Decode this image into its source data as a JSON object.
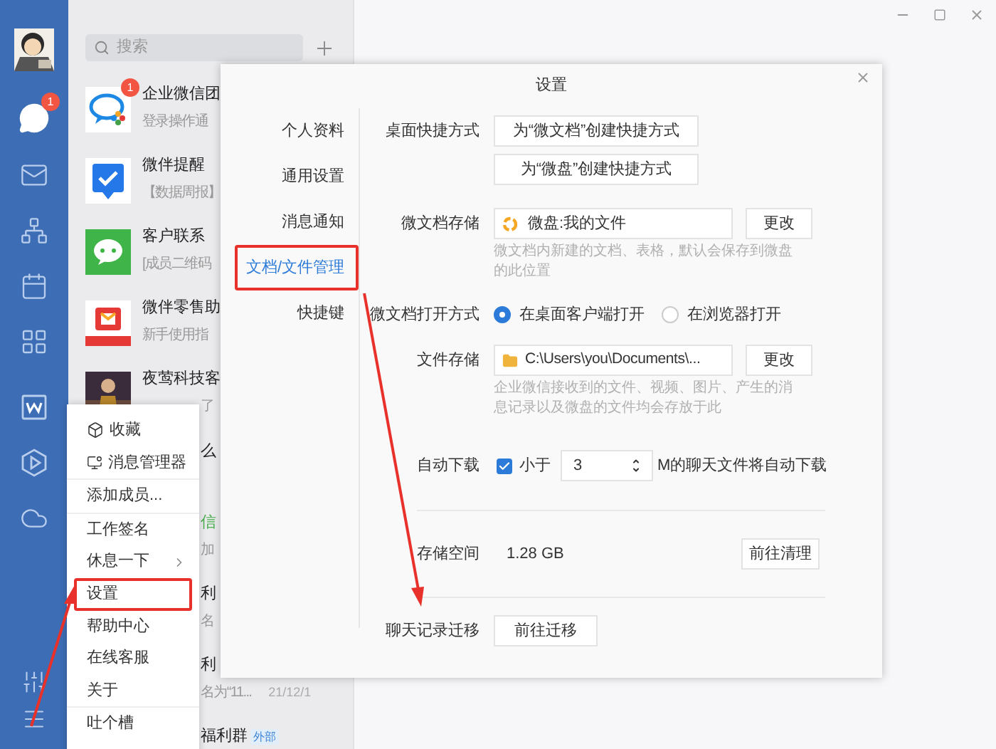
{
  "sidebar": {
    "badge": "1"
  },
  "search": {
    "placeholder": "搜索"
  },
  "chats": [
    {
      "kind": "full",
      "title": "企业微信团",
      "preview": "登录操作通",
      "badge": "1"
    },
    {
      "kind": "full",
      "title": "微伴提醒",
      "preview": "【数据周报】"
    },
    {
      "kind": "full",
      "title": "客户联系",
      "preview": "[成员二维码"
    },
    {
      "kind": "full",
      "title": "微伴零售助",
      "preview": "新手使用指"
    },
    {
      "kind": "half",
      "title": "夜莺科技客",
      "preview": "了"
    },
    {
      "kind": "covered",
      "title": "么"
    },
    {
      "kind": "covered",
      "title": "信",
      "color": "#4caf50",
      "preview": "加"
    },
    {
      "kind": "covered",
      "title": "利",
      "preview": "名"
    },
    {
      "kind": "covered",
      "title": "利",
      "preview": "名为“11...",
      "time": "21/12/1"
    },
    {
      "kind": "covered",
      "title": "福利群",
      "tag": "外部"
    }
  ],
  "settings": {
    "title": "设置",
    "nav": [
      {
        "label": "个人资料",
        "selected": false,
        "highlighted": false
      },
      {
        "label": "通用设置",
        "selected": false,
        "highlighted": false
      },
      {
        "label": "消息通知",
        "selected": false,
        "highlighted": false
      },
      {
        "label": "文档/文件管理",
        "selected": true,
        "highlighted": true
      },
      {
        "label": "快捷键",
        "selected": false,
        "highlighted": false
      }
    ],
    "shortcut": {
      "label": "桌面快捷方式",
      "buttons": [
        "为“微文档”创建快捷方式",
        "为“微盘”创建快捷方式"
      ]
    },
    "doc_storage": {
      "label": "微文档存储",
      "value": "微盘:我的文件",
      "button": "更改",
      "hint": "微文档内新建的文档、表格，默认会保存到微盘的此位置"
    },
    "open_mode": {
      "label": "微文档打开方式",
      "options": [
        {
          "label": "在桌面客户端打开",
          "selected": true
        },
        {
          "label": "在浏览器打开",
          "selected": false
        }
      ]
    },
    "file_storage": {
      "label": "文件存储",
      "value": "C:\\Users\\you\\Documents\\...",
      "button": "更改",
      "hint": "企业微信接收到的文件、视频、图片、产生的消息记录以及微盘的文件均会存放于此"
    },
    "auto_download": {
      "label": "自动下载",
      "checked": true,
      "prefix": "小于",
      "value": "3",
      "suffix": "M的聊天文件将自动下载"
    },
    "storage": {
      "label": "存储空间",
      "value": "1.28 GB",
      "button": "前往清理"
    },
    "migrate": {
      "label": "聊天记录迁移",
      "button": "前往迁移"
    }
  },
  "menu": [
    [
      {
        "label": "收藏",
        "submenu": false,
        "highlighted": false
      },
      {
        "label": "消息管理器",
        "submenu": false,
        "highlighted": false
      }
    ],
    [
      {
        "label": "添加成员...",
        "submenu": false,
        "highlighted": false
      }
    ],
    [
      {
        "label": "工作签名",
        "submenu": false,
        "highlighted": false
      },
      {
        "label": "休息一下",
        "submenu": true,
        "highlighted": false
      },
      {
        "label": "设置",
        "submenu": false,
        "highlighted": true
      },
      {
        "label": "帮助中心",
        "submenu": false,
        "highlighted": false
      },
      {
        "label": "在线客服",
        "submenu": false,
        "highlighted": false
      },
      {
        "label": "关于",
        "submenu": false,
        "highlighted": false
      }
    ],
    [
      {
        "label": "吐个槽",
        "submenu": false,
        "highlighted": false
      }
    ]
  ]
}
